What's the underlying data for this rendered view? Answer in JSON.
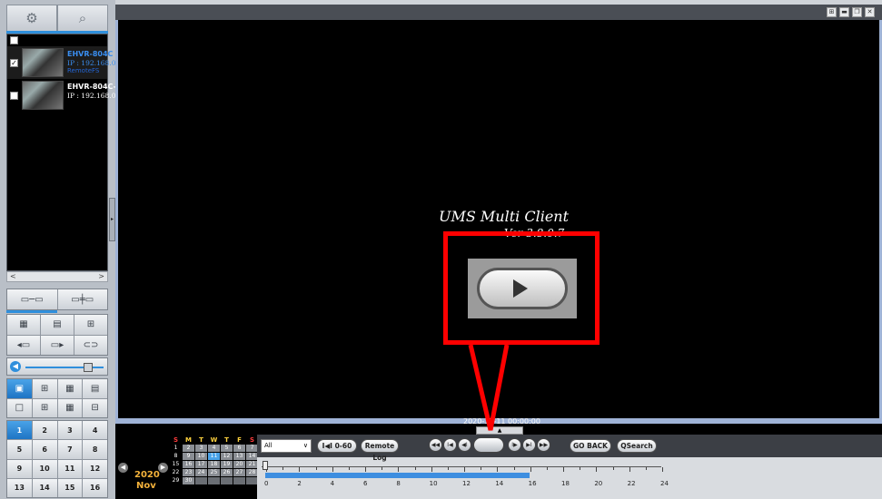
{
  "left_panel": {
    "devices": [
      {
        "name": "EHVR-804C",
        "ip": "IP : 192.168.0",
        "note": "RemoteFS",
        "checked": "✓",
        "name_color": "#3a8ef0",
        "ip_color": "#3a8ef0"
      },
      {
        "name": "EHVR-804C-",
        "ip": "IP : 192.168.0",
        "note": "",
        "checked": "",
        "name_color": "#ffffff",
        "ip_color": "#ffffff"
      }
    ],
    "scroll_left": "<",
    "scroll_right": ">",
    "collapse": "▸",
    "pages": [
      "1",
      "2",
      "3",
      "4",
      "5",
      "6",
      "7",
      "8",
      "9",
      "10",
      "11",
      "12",
      "13",
      "14",
      "15",
      "16"
    ]
  },
  "video": {
    "app_name": "UMS Multi Client",
    "version": "Ver 3.8.0.7",
    "timestamp": "2020-11-11 00:00:00",
    "tab_glyph": "▲"
  },
  "window_controls": [
    "⊞",
    "▬",
    "❐",
    "✕"
  ],
  "calendar": {
    "year": "2020",
    "month": "Nov",
    "prev": "◀",
    "next": "▶",
    "headers": [
      "S",
      "M",
      "T",
      "W",
      "T",
      "F",
      "S"
    ],
    "header_colors": [
      "#ff3b3b",
      "#ffd23f",
      "#ffd23f",
      "#ffd23f",
      "#ffd23f",
      "#ffd23f",
      "#ff3b3b"
    ],
    "days": [
      "1",
      "2",
      "3",
      "4",
      "5",
      "6",
      "7",
      "8",
      "9",
      "10",
      "11",
      "12",
      "13",
      "14",
      "15",
      "16",
      "17",
      "18",
      "19",
      "20",
      "21",
      "22",
      "23",
      "24",
      "25",
      "26",
      "27",
      "28",
      "29",
      "30",
      "",
      "",
      "",
      "",
      ""
    ],
    "highlight_day": "11"
  },
  "playback": {
    "filter_value": "All",
    "filter_caret": "∨",
    "range_label": "I◀I 0-60",
    "remote_log_label": "Remote Log",
    "go_back_label": "GO BACK",
    "qsearch_label": "QSearch",
    "left_controls": [
      "◀◀",
      "I◀",
      "◀I"
    ],
    "right_controls": [
      "I▶",
      "▶I",
      "▶▶"
    ],
    "timeline_labels": [
      "0",
      "2",
      "4",
      "6",
      "8",
      "10",
      "12",
      "14",
      "16",
      "18",
      "20",
      "22",
      "24"
    ],
    "recorded_until_hour": 16
  },
  "callout_color": "#ff0000"
}
